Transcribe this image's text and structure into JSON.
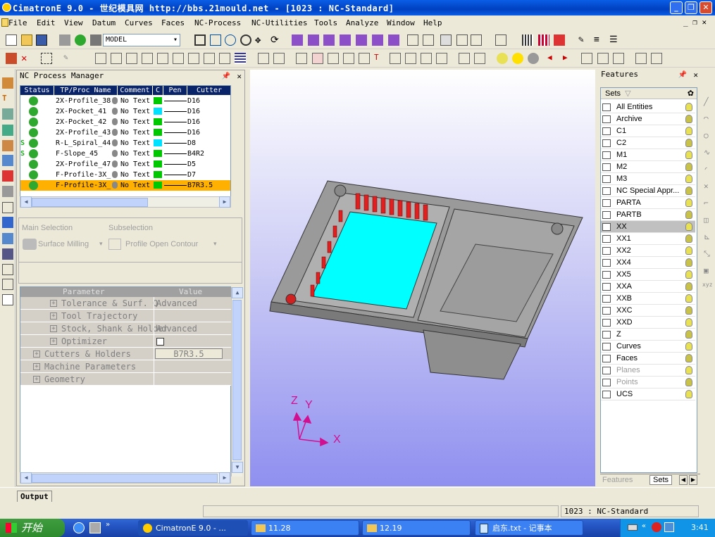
{
  "window": {
    "title": "CimatronE 9.0 - 世纪模具网 http://bbs.21mould.net - [1023 : NC-Standard]"
  },
  "menu": [
    "File",
    "Edit",
    "View",
    "Datum",
    "Curves",
    "Faces",
    "NC-Process",
    "NC-Utilities",
    "Tools",
    "Analyze",
    "Window",
    "Help"
  ],
  "toolbar": {
    "model_select": "MODEL"
  },
  "nc_process_manager": {
    "title": "NC Process Manager",
    "columns": [
      "Status",
      "TP/Proc Name",
      "Comment",
      "C",
      "Pen",
      "Cutter"
    ],
    "rows": [
      {
        "status": "ok",
        "name": "2X-Profile_38",
        "comment": "No Text",
        "color": "#00c800",
        "cutter": "D16"
      },
      {
        "status": "ok",
        "name": "2X-Pocket_41",
        "comment": "No Text",
        "color": "#00e0ff",
        "cutter": "D16"
      },
      {
        "status": "ok",
        "name": "2X-Pocket_42",
        "comment": "No Text",
        "color": "#00c800",
        "cutter": "D16"
      },
      {
        "status": "ok",
        "name": "2X-Profile_43",
        "comment": "No Text",
        "color": "#00c800",
        "cutter": "D16"
      },
      {
        "status": "warn",
        "name": "R-L_Spiral_44",
        "comment": "No Text",
        "color": "#00e0ff",
        "cutter": "D8"
      },
      {
        "status": "warn",
        "name": "F-Slope_45",
        "comment": "No Text",
        "color": "#00c800",
        "cutter": "B4R2"
      },
      {
        "status": "ok",
        "name": "2X-Profile_47",
        "comment": "No Text",
        "color": "#00c800",
        "cutter": "D5"
      },
      {
        "status": "ok",
        "name": "F-Profile-3X_",
        "comment": "No Text",
        "color": "#00c800",
        "cutter": "D7"
      },
      {
        "status": "ok",
        "name": "F-Profile-3X_",
        "comment": "No Text",
        "color": "#00c800",
        "cutter": "B7R3.5"
      }
    ]
  },
  "selection": {
    "main_label": "Main Selection",
    "sub_label": "Subselection",
    "main_value": "Surface Milling",
    "sub_value": "Profile Open Contour"
  },
  "params": {
    "header_param": "Parameter",
    "header_value": "Value",
    "rows": [
      {
        "name": "Tolerance & Surf. Q",
        "value": "Advanced"
      },
      {
        "name": "Tool Trajectory",
        "value": ""
      },
      {
        "name": "Stock, Shank & Holder",
        "value": "Advanced"
      },
      {
        "name": "Optimizer",
        "value": ""
      },
      {
        "name": "Cutters & Holders",
        "value": "B7R3.5"
      },
      {
        "name": "Machine Parameters",
        "value": ""
      },
      {
        "name": "Geometry",
        "value": ""
      }
    ]
  },
  "features": {
    "title": "Features",
    "sets_header": "Sets",
    "items": [
      "All Entities",
      "Archive",
      "C1",
      "C2",
      "M1",
      "M2",
      "M3",
      "NC Special Appr...",
      "PARTA",
      "PARTB",
      "XX",
      "XX1",
      "XX2",
      "XX4",
      "XX5",
      "XXA",
      "XXB",
      "XXC",
      "XXD",
      "Z",
      "Curves",
      "Faces",
      "Planes",
      "Points",
      "UCS"
    ],
    "tab_features": "Features",
    "tab_sets": "Sets"
  },
  "axes": {
    "z": "Z",
    "y": "Y",
    "x": "X"
  },
  "output_tab": "Output",
  "status_text": "1023 : NC-Standard",
  "taskbar": {
    "start": "开始",
    "tasks": [
      "CimatronE 9.0 - ...",
      "11.28",
      "12.19",
      "启东.txt - 记事本"
    ],
    "clock": "3:41"
  }
}
